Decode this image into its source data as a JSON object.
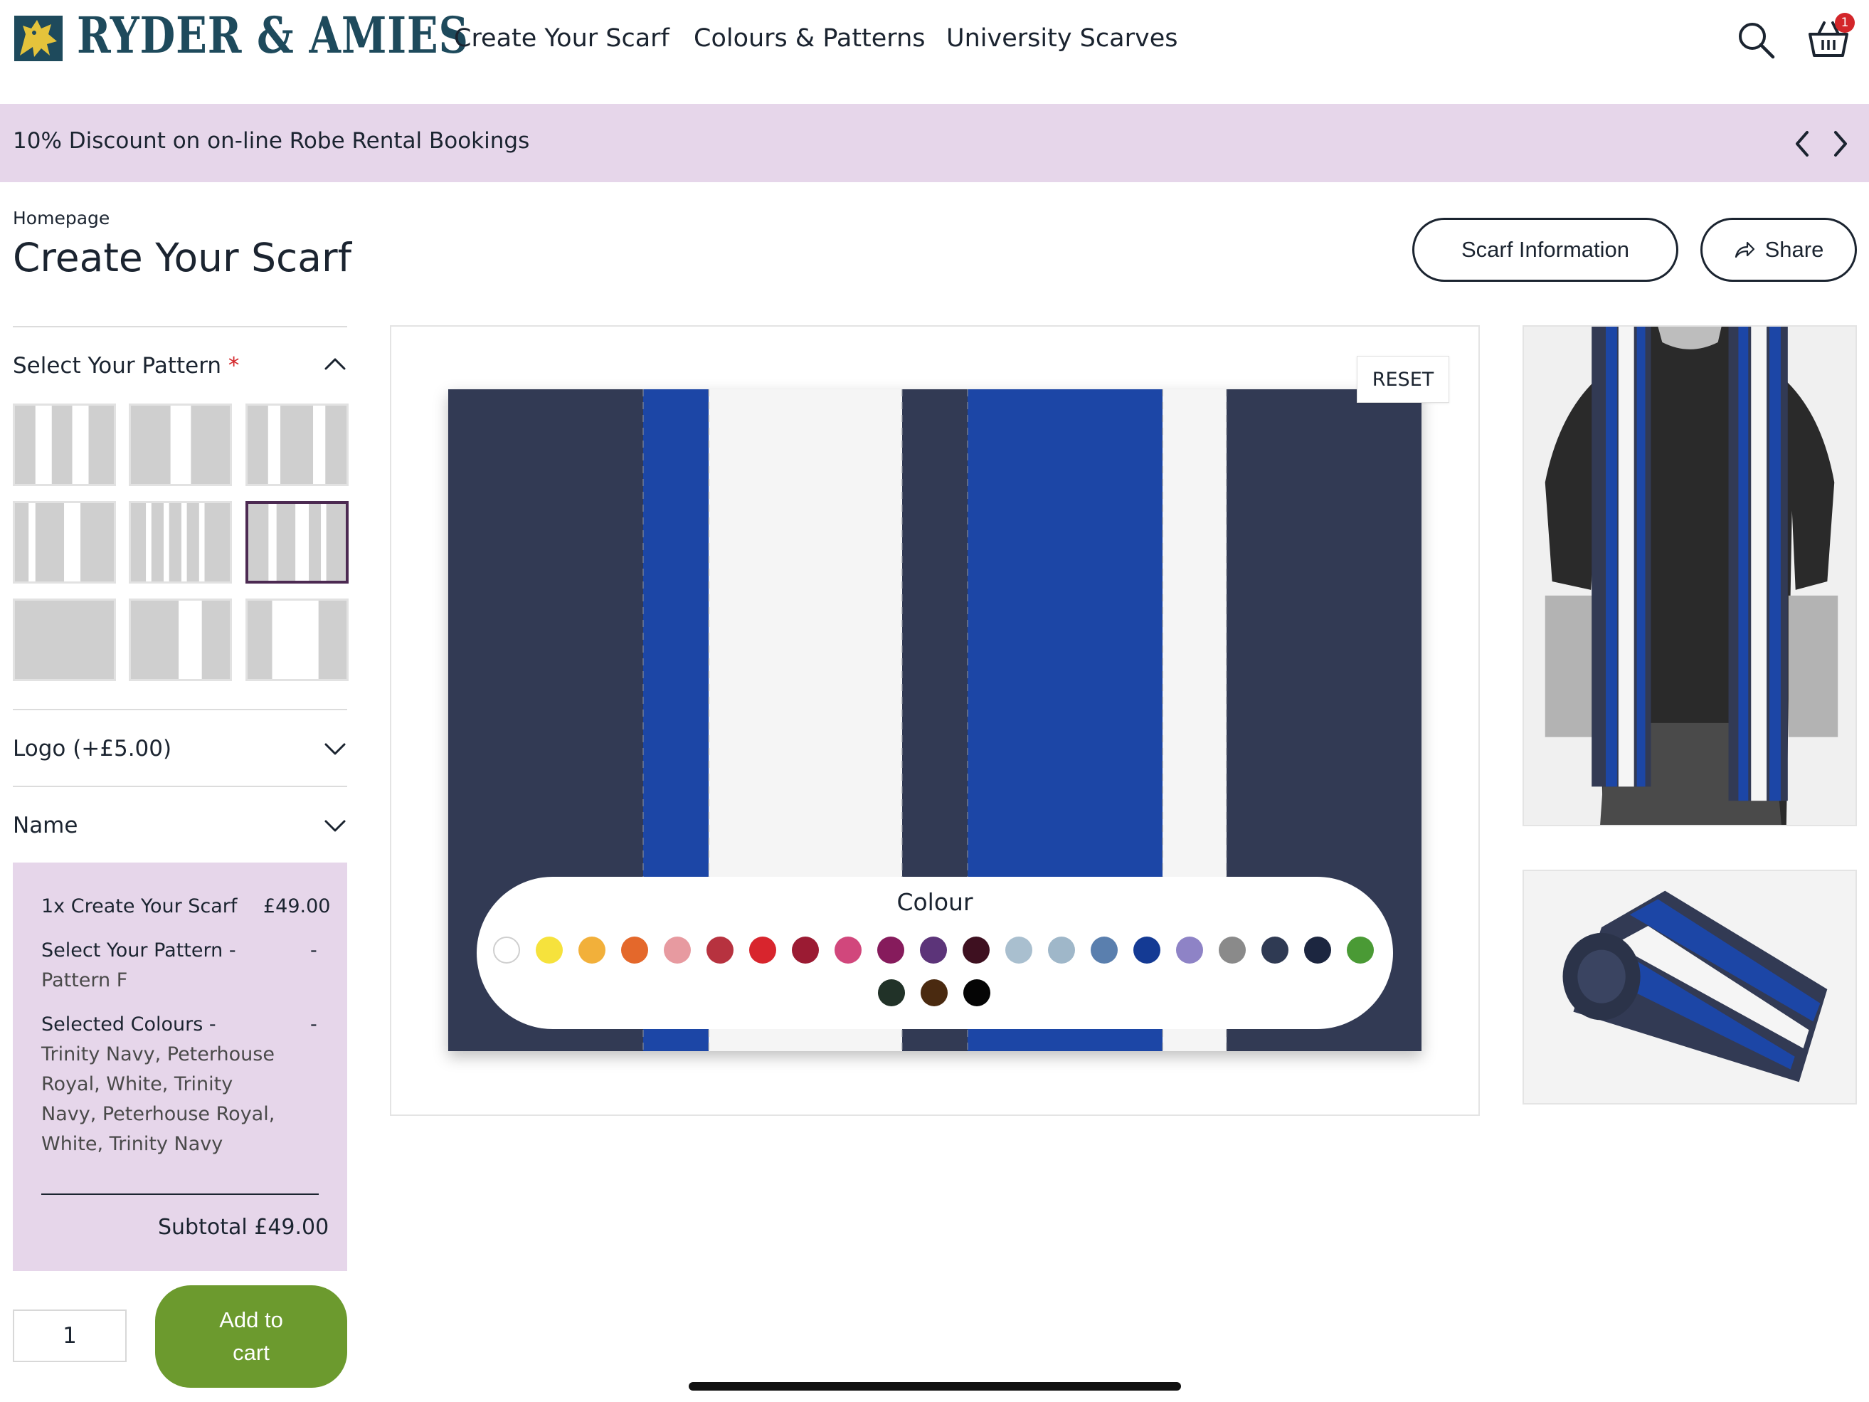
{
  "header": {
    "brand": "RYDER & AMIES",
    "nav": [
      "Create Your Scarf",
      "Colours & Patterns",
      "University Scarves"
    ],
    "cart_count": "1"
  },
  "promo": {
    "text": "10% Discount on on-line Robe Rental Bookings"
  },
  "page": {
    "breadcrumb": "Homepage",
    "title": "Create Your Scarf",
    "scarf_info_label": "Scarf Information",
    "share_label": "Share"
  },
  "sidebar": {
    "pattern_section": {
      "label": "Select Your Pattern",
      "required_mark": "*",
      "selected_index": 5,
      "pattern_count": 9
    },
    "logo_section": {
      "label": "Logo (+£5.00)"
    },
    "name_section": {
      "label": "Name"
    },
    "summary": {
      "item_line": "1x Create Your Scarf",
      "item_price": "£49.00",
      "pattern_label": "Select Your Pattern -",
      "pattern_dash": "-",
      "pattern_value": "Pattern F",
      "colours_label": "Selected Colours -",
      "colours_dash": "-",
      "colours_lines": [
        "Trinity Navy, Peterhouse",
        "Royal, White, Trinity",
        "Navy, Peterhouse Royal,",
        "White, Trinity Navy"
      ],
      "subtotal": "Subtotal £49.00"
    },
    "quantity": "1",
    "add_to_cart_line1": "Add to",
    "add_to_cart_line2": "cart"
  },
  "canvas": {
    "reset_label": "RESET",
    "stripe_colours": [
      "#323a54",
      "#1c46a6",
      "#f5f5f5",
      "#323a54",
      "#1c46a6",
      "#f5f5f5",
      "#323a54"
    ],
    "colour_panel_title": "Colour",
    "swatches": [
      "#ffffff",
      "#f6e23c",
      "#f2b03a",
      "#e4682b",
      "#e79aa0",
      "#b7323f",
      "#d8252d",
      "#9b1b33",
      "#d1477c",
      "#861b5c",
      "#5c3479",
      "#3e1020",
      "#a9bfcf",
      "#9fb7c9",
      "#5a7fae",
      "#143a94",
      "#8e83c6",
      "#8a8a8a",
      "#2f3a53",
      "#1c2640",
      "#4a9a35",
      "#213228",
      "#4a2a10",
      "#050505"
    ]
  },
  "colors": {
    "accent_purple": "#e6d6ea",
    "button_green": "#6c9a2e",
    "badge_red": "#d3262a",
    "text_dark": "#1b2430"
  }
}
